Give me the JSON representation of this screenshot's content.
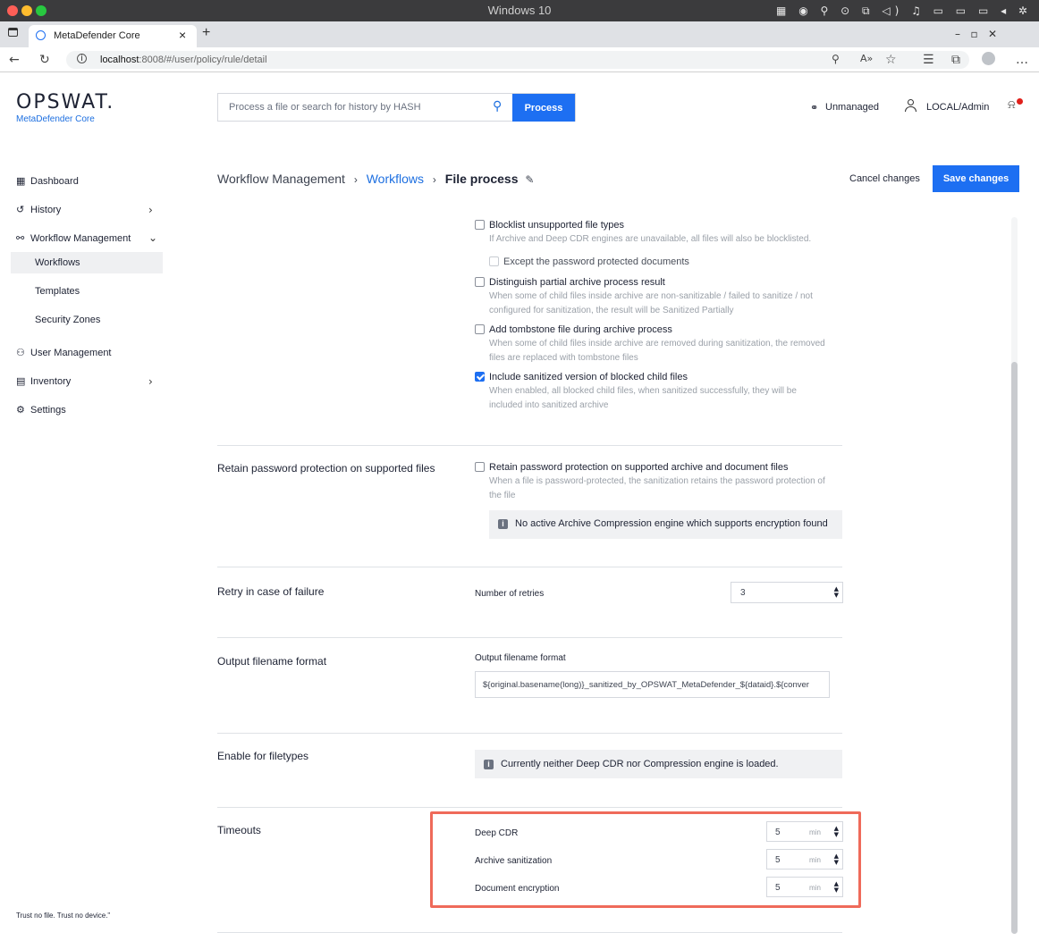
{
  "os": {
    "window_title": "Windows 10",
    "system_icons": "▦ ◉ ⚲ ⊙ ⧉ ◁) ♫ ▭ ▭ ▭ ◂ ✲"
  },
  "browser": {
    "tab_title": "MetaDefender Core",
    "tab_close": "×",
    "new_tab": "+",
    "url_host": "localhost",
    "url_rest": ":8008/#/user/policy/rule/detail",
    "window_controls": "–   ▫   ✕"
  },
  "app": {
    "brand": "OPSWAT.",
    "product": "MetaDefender Core",
    "search_placeholder": "Process a file or search for history by HASH",
    "process_label": "Process",
    "unmanaged_label": "Unmanaged",
    "user_label": "LOCAL/Admin"
  },
  "sidebar": {
    "dashboard": "Dashboard",
    "history": "History",
    "workflow_management": "Workflow Management",
    "workflows": "Workflows",
    "templates": "Templates",
    "security_zones": "Security Zones",
    "user_management": "User Management",
    "inventory": "Inventory",
    "settings": "Settings",
    "footer": "Trust no file. Trust no device.\""
  },
  "breadcrumb": {
    "root": "Workflow Management",
    "middle": "Workflows",
    "current": "File process"
  },
  "actions": {
    "cancel": "Cancel changes",
    "save": "Save changes"
  },
  "archive_options": {
    "blocklist": {
      "label": "Blocklist unsupported file types",
      "desc": "If Archive and Deep CDR engines are unavailable, all files will also be blocklisted.",
      "checked": false
    },
    "except_password": {
      "label": "Except the password protected documents",
      "checked": false
    },
    "distinguish": {
      "label": "Distinguish partial archive process result",
      "desc1": "When some of child files inside archive are non-sanitizable / failed to sanitize / not",
      "desc2": "configured for sanitization, the result will be Sanitized Partially",
      "checked": false
    },
    "tombstone": {
      "label": "Add tombstone file during archive process",
      "desc1": "When some of child files inside archive are removed during sanitization, the removed",
      "desc2": "files are replaced with tombstone files",
      "checked": false
    },
    "include_sanitized": {
      "label": "Include sanitized version of blocked child files",
      "desc1": "When enabled, all blocked child files, when sanitized successfully, they will be",
      "desc2": "included into sanitized archive",
      "checked": true
    }
  },
  "retain_password": {
    "title": "Retain password protection on supported files",
    "label": "Retain password protection on supported archive and document files",
    "desc1": "When a file is password-protected, the sanitization retains the password protection of",
    "desc2": "the file",
    "info": "No active Archive Compression engine which supports encryption found",
    "checked": false
  },
  "retry": {
    "title": "Retry in case of failure",
    "label": "Number of retries",
    "value": "3"
  },
  "output_filename": {
    "title": "Output filename format",
    "label": "Output filename format",
    "value": "${original.basename(long)}_sanitized_by_OPSWAT_MetaDefender_${dataid}.${conver"
  },
  "filetypes": {
    "title": "Enable for filetypes",
    "info": "Currently neither Deep CDR nor Compression engine is loaded."
  },
  "timeouts": {
    "title": "Timeouts",
    "unit": "min",
    "deep_cdr": {
      "label": "Deep CDR",
      "value": "5"
    },
    "archive": {
      "label": "Archive sanitization",
      "value": "5"
    },
    "encryption": {
      "label": "Document encryption",
      "value": "5"
    }
  }
}
